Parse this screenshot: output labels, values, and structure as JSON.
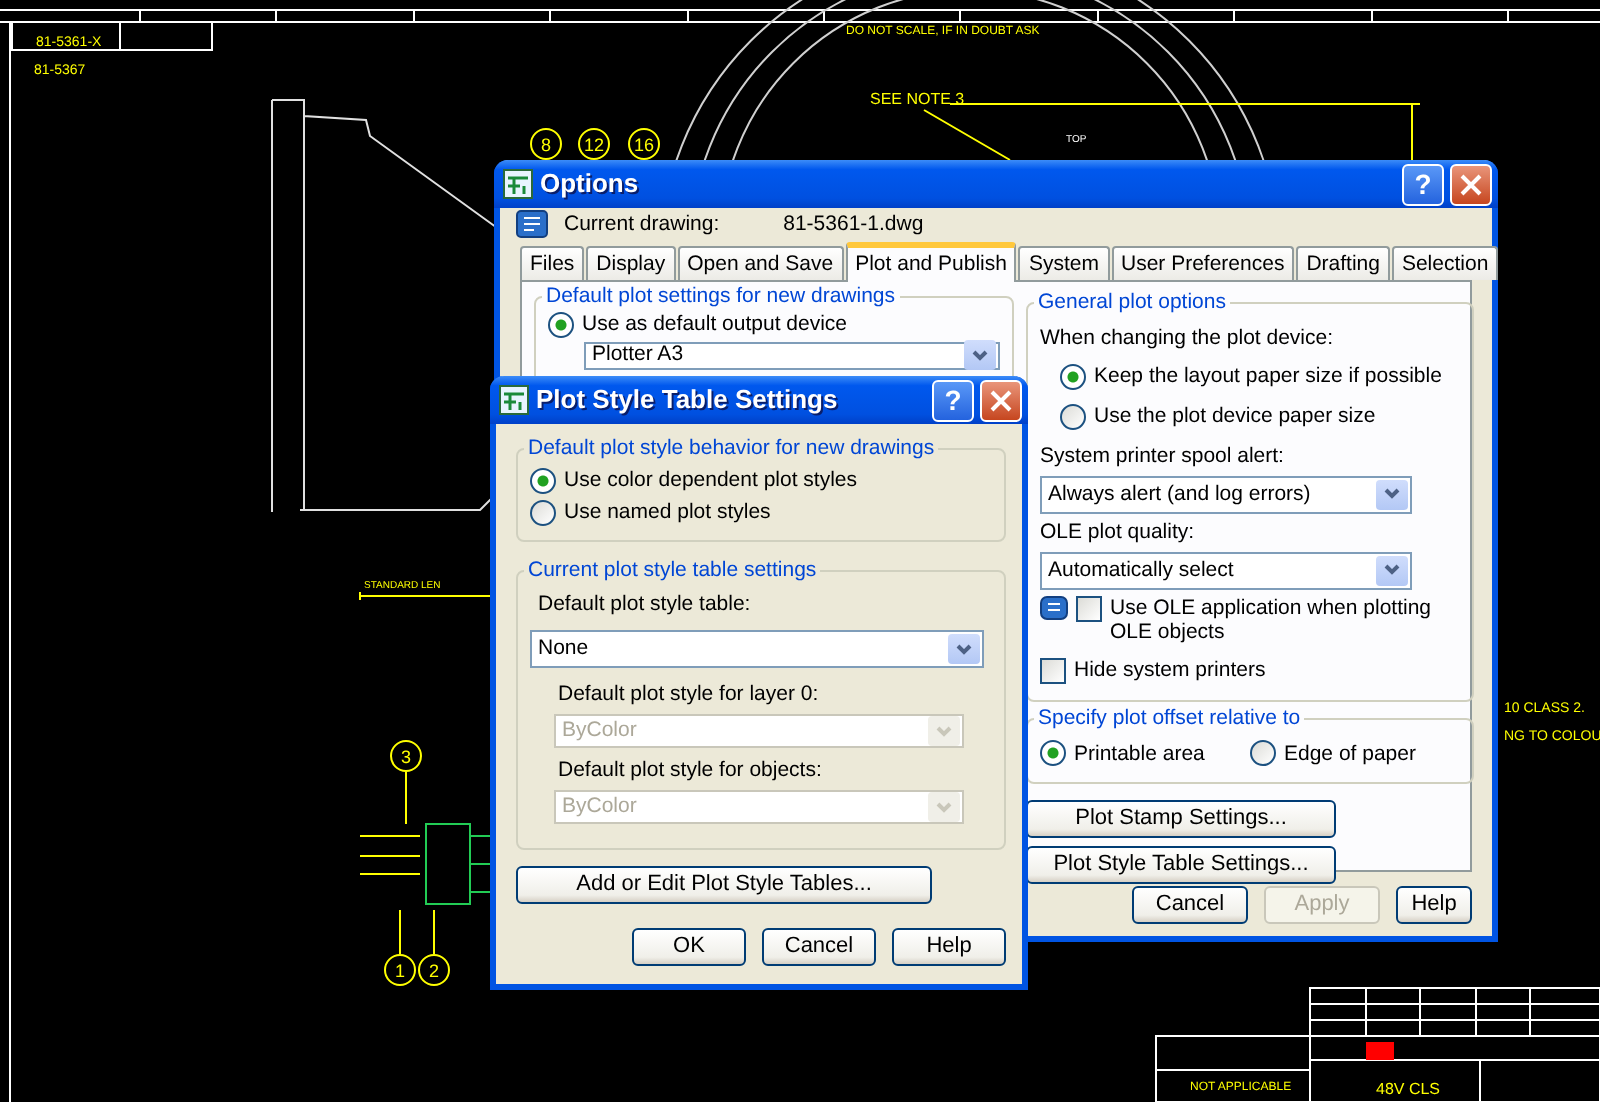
{
  "drawing": {
    "drawing_number": "81-5361-X",
    "mod_number": "81-5367",
    "scale_note": "DO NOT SCALE, IF IN DOUBT ASK",
    "note_callout": "SEE NOTE 3",
    "view_label": "TOP",
    "top_balloons": [
      "8",
      "12",
      "16"
    ],
    "dimension_label": "STANDARD LEN",
    "pin_balloons": [
      "3",
      "1",
      "2"
    ],
    "side_notes": [
      "10 CLASS 2.",
      "NG TO COLOU"
    ],
    "title_block": {
      "description": "NOT APPLICABLE",
      "title": "48V CLS"
    }
  },
  "options_dialog": {
    "title": "Options",
    "help_button": "?",
    "current_drawing_label": "Current drawing:",
    "current_drawing": "81-5361-1.dwg",
    "tabs": [
      {
        "label": "Files",
        "selected": false
      },
      {
        "label": "Display",
        "selected": false
      },
      {
        "label": "Open and Save",
        "selected": false
      },
      {
        "label": "Plot and Publish",
        "selected": true
      },
      {
        "label": "System",
        "selected": false
      },
      {
        "label": "User Preferences",
        "selected": false
      },
      {
        "label": "Drafting",
        "selected": false
      },
      {
        "label": "Selection",
        "selected": false
      }
    ],
    "default_group": {
      "title": "Default plot settings for new drawings",
      "options": [
        {
          "label": "Use as default output device",
          "selected": true
        }
      ],
      "device": "Plotter A3"
    },
    "general_group": {
      "title": "General plot options",
      "device_change_label": "When changing the plot device:",
      "paper_options": [
        {
          "label": "Keep the layout paper size if possible",
          "selected": true
        },
        {
          "label": "Use the plot device paper size",
          "selected": false
        }
      ],
      "spool_alert_label": "System printer spool alert:",
      "spool_alert": "Always alert (and log errors)",
      "ole_quality_label": "OLE plot quality:",
      "ole_quality": "Automatically select",
      "checkboxes": [
        {
          "label": "Use OLE application when plotting OLE objects",
          "checked": false
        },
        {
          "label": "Hide system printers",
          "checked": false
        }
      ]
    },
    "offset_group": {
      "title": "Specify plot offset relative to",
      "options": [
        {
          "label": "Printable area",
          "selected": true
        },
        {
          "label": "Edge of paper",
          "selected": false
        }
      ]
    },
    "side_buttons": [
      "Plot Stamp Settings...",
      "Plot Style Table Settings..."
    ],
    "footer_buttons": [
      {
        "label": "Cancel",
        "disabled": false
      },
      {
        "label": "Apply",
        "disabled": true
      },
      {
        "label": "Help",
        "disabled": false
      }
    ]
  },
  "plot_style_dialog": {
    "title": "Plot Style Table Settings",
    "help_button": "?",
    "behavior_group": {
      "title": "Default plot style behavior for new drawings",
      "options": [
        {
          "label": "Use color dependent plot styles",
          "selected": true
        },
        {
          "label": "Use named plot styles",
          "selected": false
        }
      ]
    },
    "table_group": {
      "title": "Current plot style table settings",
      "fields": [
        {
          "label": "Default plot style table:",
          "value": "None",
          "disabled": false
        },
        {
          "label": "Default plot style for layer 0:",
          "value": "ByColor",
          "disabled": true
        },
        {
          "label": "Default plot style for objects:",
          "value": "ByColor",
          "disabled": true
        }
      ]
    },
    "edit_button": "Add or Edit Plot Style Tables...",
    "footer_buttons": [
      {
        "label": "OK",
        "disabled": false
      },
      {
        "label": "Cancel",
        "disabled": false
      },
      {
        "label": "Help",
        "disabled": false
      }
    ]
  }
}
